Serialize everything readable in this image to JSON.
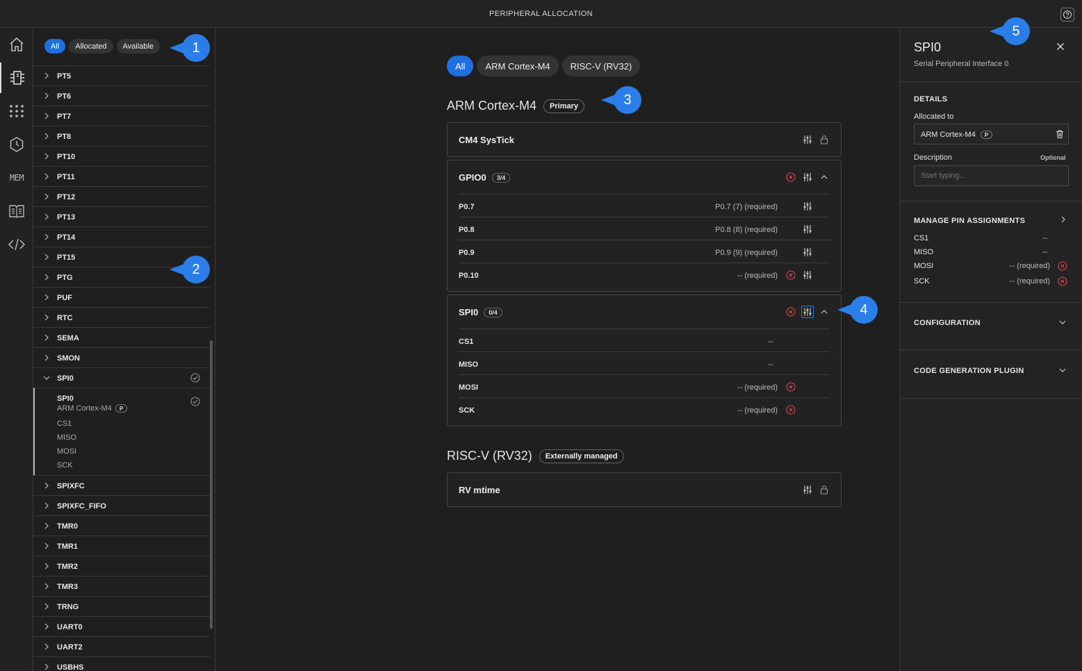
{
  "app": {
    "title": "PERIPHERAL ALLOCATION",
    "help_icon": "help-icon"
  },
  "rail": {
    "items": [
      {
        "name": "home-icon"
      },
      {
        "name": "peripherals-icon",
        "active": true
      },
      {
        "name": "pins-icon"
      },
      {
        "name": "clock-icon"
      },
      {
        "name": "memory-icon",
        "text": "MEM"
      },
      {
        "name": "docs-icon"
      },
      {
        "name": "code-icon"
      }
    ]
  },
  "list_filters": {
    "all": "All",
    "allocated": "Allocated",
    "available": "Available"
  },
  "peripherals_before": [
    "PT5",
    "PT6",
    "PT7",
    "PT8",
    "PT10",
    "PT11",
    "PT12",
    "PT13",
    "PT14",
    "PT15",
    "PTG",
    "PUF",
    "RTC",
    "SEMA",
    "SMON"
  ],
  "expanded": {
    "name": "SPI0",
    "allocation_name": "SPI0",
    "allocation_core": "ARM Cortex-M4",
    "primary_badge": "P",
    "pins": [
      "CS1",
      "MISO",
      "MOSI",
      "SCK"
    ]
  },
  "peripherals_after": [
    "SPIXFC",
    "SPIXFC_FIFO",
    "TMR0",
    "TMR1",
    "TMR2",
    "TMR3",
    "TRNG",
    "UART0",
    "UART2",
    "USBHS"
  ],
  "core_filters": {
    "all": "All",
    "arm": "ARM Cortex-M4",
    "riscv": "RISC-V (RV32)"
  },
  "arm_section": {
    "title": "ARM Cortex-M4",
    "tag": "Primary",
    "systick": "CM4 SysTick",
    "gpio": {
      "name": "GPIO0",
      "count": "3/4",
      "pins": [
        {
          "name": "P0.7",
          "value": "P0.7 (7) (required)"
        },
        {
          "name": "P0.8",
          "value": "P0.8 (8) (required)"
        },
        {
          "name": "P0.9",
          "value": "P0.9 (9) (required)"
        },
        {
          "name": "P0.10",
          "value": "-- (required)"
        }
      ]
    },
    "spi": {
      "name": "SPI0",
      "count": "0/4",
      "pins": [
        {
          "name": "CS1",
          "value": "--"
        },
        {
          "name": "MISO",
          "value": "--"
        },
        {
          "name": "MOSI",
          "value": "-- (required)"
        },
        {
          "name": "SCK",
          "value": "-- (required)"
        }
      ]
    }
  },
  "riscv_section": {
    "title": "RISC-V (RV32)",
    "tag": "Externally managed",
    "timer": "RV mtime"
  },
  "detail": {
    "title": "SPI0",
    "subtitle": "Serial Peripheral Interface 0",
    "details_label": "DETAILS",
    "allocated_label": "Allocated to",
    "allocated_value": "ARM Cortex-M4",
    "allocated_badge": "P",
    "description_label": "Description",
    "optional_label": "Optional",
    "description_placeholder": "Start typing...",
    "manage_label": "MANAGE PIN ASSIGNMENTS",
    "pins": [
      {
        "name": "CS1",
        "value": "--"
      },
      {
        "name": "MISO",
        "value": "--"
      },
      {
        "name": "MOSI",
        "value": "-- (required)"
      },
      {
        "name": "SCK",
        "value": "-- (required)"
      }
    ],
    "configuration_label": "CONFIGURATION",
    "codegen_label": "CODE GENERATION PLUGIN"
  },
  "callouts": [
    "1",
    "2",
    "3",
    "4",
    "5"
  ],
  "colors": {
    "accent": "#1f6fe0",
    "error": "#e0484f",
    "callout": "#2b7ee8"
  }
}
